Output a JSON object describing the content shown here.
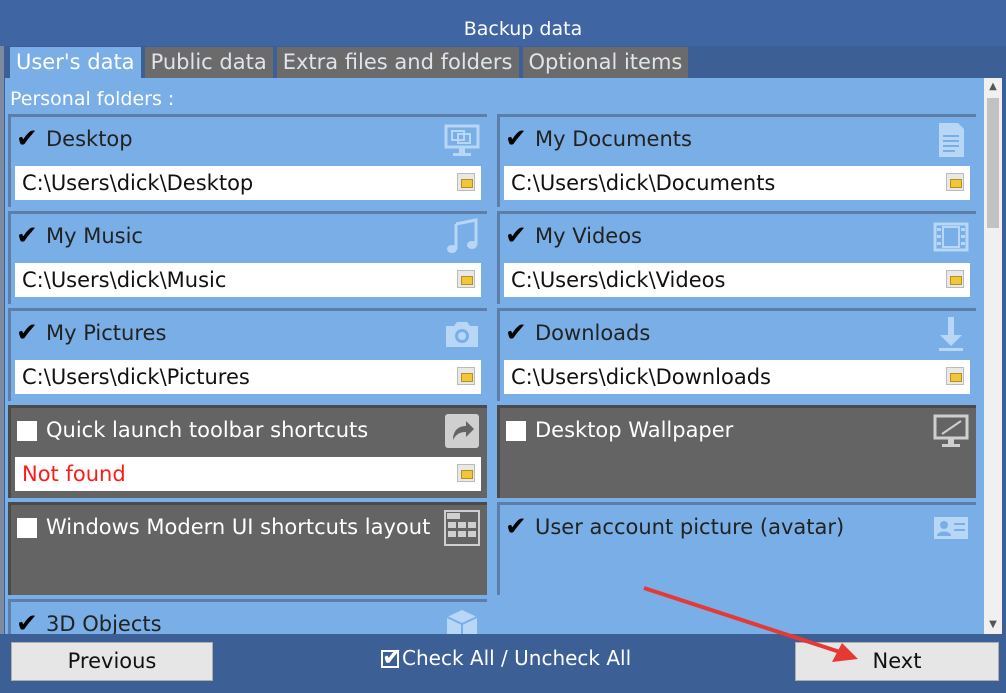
{
  "window": {
    "title": "Backup data"
  },
  "tabs": [
    {
      "label": "User's data",
      "active": true
    },
    {
      "label": "Public data",
      "active": false
    },
    {
      "label": "Extra files and folders",
      "active": false
    },
    {
      "label": "Optional items",
      "active": false
    }
  ],
  "section": {
    "title": "Personal folders :"
  },
  "items": {
    "desktop": {
      "label": "Desktop",
      "checked": true,
      "path": "C:\\Users\\dick\\Desktop",
      "icon": "monitor-icon"
    },
    "documents": {
      "label": "My Documents",
      "checked": true,
      "path": "C:\\Users\\dick\\Documents",
      "icon": "document-icon"
    },
    "music": {
      "label": "My Music",
      "checked": true,
      "path": "C:\\Users\\dick\\Music",
      "icon": "music-note-icon"
    },
    "videos": {
      "label": "My Videos",
      "checked": true,
      "path": "C:\\Users\\dick\\Videos",
      "icon": "film-icon"
    },
    "pictures": {
      "label": "My Pictures",
      "checked": true,
      "path": "C:\\Users\\dick\\Pictures",
      "icon": "camera-icon"
    },
    "downloads": {
      "label": "Downloads",
      "checked": true,
      "path": "C:\\Users\\dick\\Downloads",
      "icon": "download-arrow-icon"
    },
    "quicklaunch": {
      "label": "Quick launch toolbar shortcuts",
      "checked": false,
      "path": "Not found",
      "icon": "shortcut-arrow-icon"
    },
    "wallpaper": {
      "label": "Desktop Wallpaper",
      "checked": false,
      "icon": "wallpaper-icon"
    },
    "modernui": {
      "label": "Windows Modern UI shortcuts layout",
      "checked": false,
      "icon": "start-grid-icon"
    },
    "avatar": {
      "label": "User account picture (avatar)",
      "checked": true,
      "icon": "contact-card-icon"
    },
    "objects3d": {
      "label": "3D Objects",
      "checked": true,
      "icon": "cube-icon"
    }
  },
  "footer": {
    "previous_label": "Previous",
    "checkall_label": "Check All / Uncheck All",
    "next_label": "Next"
  },
  "colors": {
    "accent": "#79aee6",
    "disabled": "#646464",
    "frame": "#3c5f95",
    "annotation_arrow": "#e53935"
  }
}
